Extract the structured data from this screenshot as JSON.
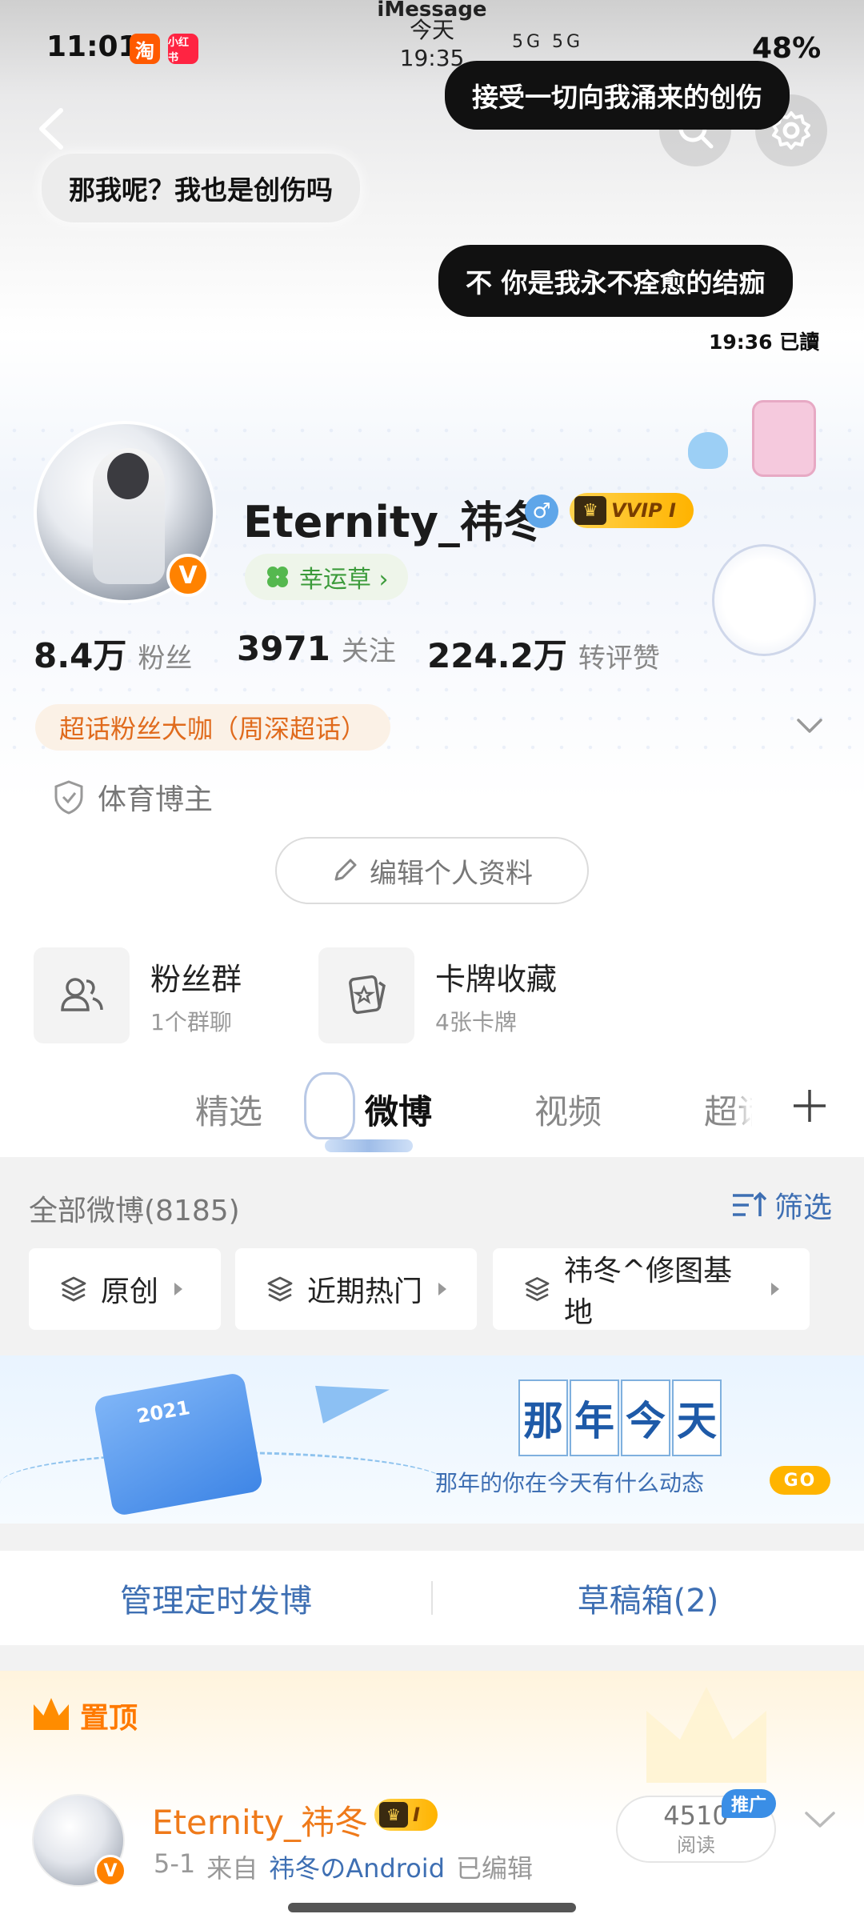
{
  "status_bar": {
    "time": "11:01",
    "taobao_badge": "淘",
    "xhs_badge": "小红书",
    "imessage_title": "iMessage",
    "imessage_time": "今天 19:35",
    "network": "5G 5G",
    "battery": "48%"
  },
  "chat": {
    "bubble_1": "接受一切向我涌来的创伤",
    "bubble_2": "那我呢？我也是创伤吗",
    "bubble_3": "不 你是我永不痊愈的结痂",
    "read_receipt": "19:36 已讀"
  },
  "profile": {
    "username": "Eternity_祎冬",
    "gender_symbol": "♂",
    "vip_label": "VVIP I",
    "verified_mark": "V",
    "lucky_label": "幸运草 ›",
    "stats": [
      {
        "num": "8.4万",
        "label": "粉丝"
      },
      {
        "num": "3971",
        "label": "关注"
      },
      {
        "num": "224.2万",
        "label": "转评赞"
      }
    ],
    "superfan_tag": "超话粉丝大咖（周深超话）",
    "sport_tag": "体育博主",
    "edit_button": "编辑个人资料"
  },
  "features": [
    {
      "title": "粉丝群",
      "sub": "1个群聊",
      "icon": "people-icon"
    },
    {
      "title": "卡牌收藏",
      "sub": "4张卡牌",
      "icon": "card-icon"
    }
  ],
  "tabs": [
    "精选",
    "微博",
    "视频",
    "超话"
  ],
  "feed": {
    "all_posts": "全部微博(8185)",
    "filter": "筛选",
    "chips": [
      "原创",
      "近期热门",
      "祎冬^修图基地"
    ]
  },
  "banner": {
    "year": "2021",
    "title_chars": [
      "那",
      "年",
      "今",
      "天"
    ],
    "subtitle": "那年的你在今天有什么动态",
    "go": "GO"
  },
  "manage": {
    "scheduled": "管理定时发博",
    "drafts": "草稿箱(2)"
  },
  "pinned": {
    "label": "置顶",
    "post": {
      "author": "Eternity_祎冬",
      "vip_label": "I",
      "date": "5-1",
      "from_prefix": "来自",
      "source": "祎冬のAndroid",
      "edited": "已编辑",
      "read_count": "4510",
      "read_label": "阅读",
      "promo": "推广"
    }
  },
  "colors": {
    "accent_orange": "#ff8200",
    "link_blue": "#3e6fb3",
    "vip_gold": "#ffc21a"
  }
}
